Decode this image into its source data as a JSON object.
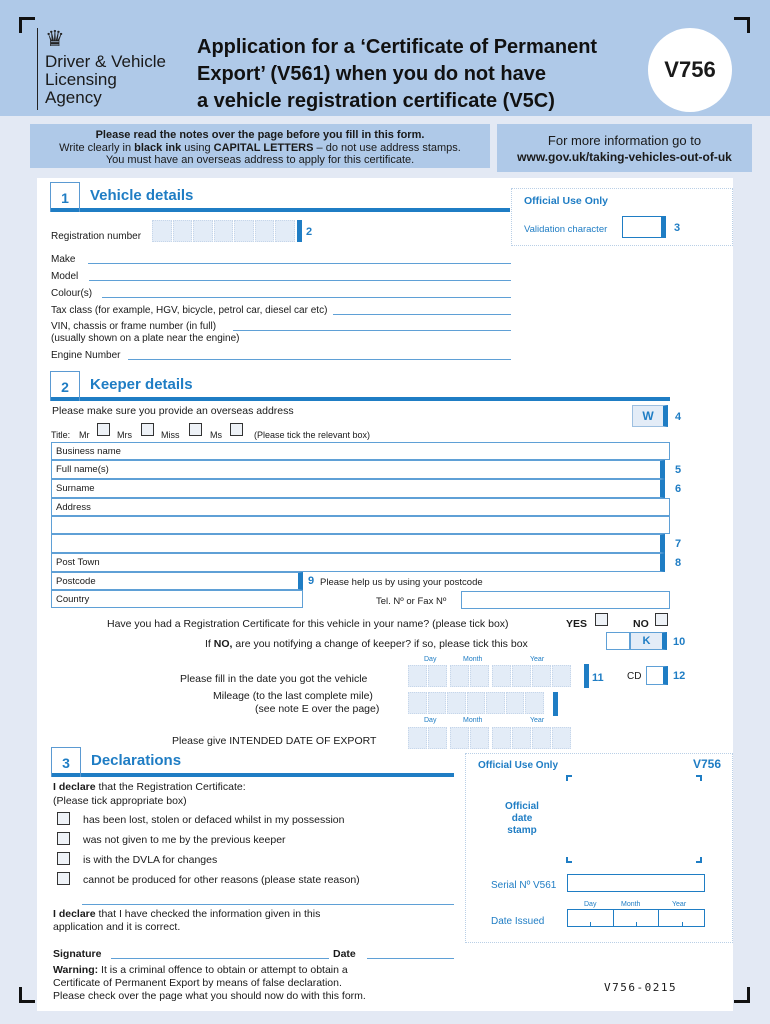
{
  "header": {
    "org_lines": [
      "Driver & Vehicle",
      "Licensing",
      "Agency"
    ],
    "title_lines": [
      "Application for a ‘Certificate of Permanent",
      "Export’ (V561) when you do not have",
      "a vehicle registration certificate (V5C)"
    ],
    "form_code": "V756",
    "crest_icon": "royal-coat-of-arms"
  },
  "notice": {
    "line1": "Please read the notes over the page before you fill in this form.",
    "line2_pre": "Write clearly in ",
    "line2_b1": "black ink",
    "line2_mid": " using ",
    "line2_b2": "CAPITAL LETTERS",
    "line2_post": " – do not use address stamps.",
    "line3": "You must have an overseas address to apply for this certificate."
  },
  "info": {
    "line1": "For more information go to",
    "url": "www.gov.uk/taking-vehicles-out-of-uk"
  },
  "section1": {
    "number": "1",
    "title": "Vehicle details",
    "registration_label": "Registration number",
    "registration_ref": "2",
    "make": "Make",
    "model": "Model",
    "colour": "Colour(s)",
    "tax_class": "Tax class (for example, HGV, bicycle, petrol car, diesel car etc)",
    "vin_line1": "VIN, chassis or frame number (in full)",
    "vin_line2": "(usually shown on a plate near the engine)",
    "engine": "Engine Number"
  },
  "official1": {
    "title": "Official Use Only",
    "validation": "Validation character",
    "ref": "3"
  },
  "section2": {
    "number": "2",
    "title": "Keeper details",
    "overseas_note": "Please make sure you provide an overseas address",
    "w_box": "W",
    "w_ref": "4",
    "title_label": "Title:",
    "titles": [
      "Mr",
      "Mrs",
      "Miss",
      "Ms"
    ],
    "title_hint": "(Please tick the relevant box)",
    "business": "Business name",
    "fullname": "Full name(s)",
    "fullname_ref": "5",
    "surname": "Surname",
    "surname_ref": "6",
    "address": "Address",
    "address_ref": "7",
    "post_town": "Post Town",
    "post_town_ref": "8",
    "postcode": "Postcode",
    "postcode_ref": "9",
    "postcode_hint": "Please help us by using your postcode",
    "country": "Country",
    "tel": "Tel. Nº or Fax Nº",
    "reg_cert_q": "Have you had a Registration Certificate for this vehicle in your name? (please tick box)",
    "yes": "YES",
    "no": "NO",
    "change_pre": "If ",
    "change_bold": "NO,",
    "change_post": " are you notifying a change of keeper? if so, please tick this box",
    "k_box": "K",
    "k_ref": "10",
    "date_got": "Please fill in the date you got the vehicle",
    "date_got_ref": "11",
    "cd_label": "CD",
    "cd_ref": "12",
    "mileage1": "Mileage (to the last complete mile)",
    "mileage2": "(see note E over the page)",
    "export_date": "Please give INTENDED DATE OF EXPORT",
    "day": "Day",
    "month": "Month",
    "year": "Year"
  },
  "section3": {
    "number": "3",
    "title": "Declarations",
    "declare_b": "I declare",
    "declare_rest": " that the Registration Certificate:",
    "tick_hint": "(Please tick appropriate box)",
    "options": [
      "has been lost, stolen or defaced whilst in my possession",
      "was not given to me by the previous keeper",
      "is with the DVLA for changes",
      "cannot be produced for other reasons (please state reason)"
    ],
    "declare2_b": "I declare",
    "declare2_rest": " that I have checked the information given in this",
    "declare2_line2": "application and it is correct.",
    "signature": "Signature",
    "date": "Date",
    "warning_b": "Warning:",
    "warning_rest": " It is a criminal offence to obtain or attempt to obtain a",
    "warning_line2": "Certificate of Permanent Export by means of false declaration.",
    "warning_line3": "Please check over the page what you should now do with this form."
  },
  "official2": {
    "title": "Official Use Only",
    "code": "V756",
    "stamp_lines": [
      "Official",
      "date",
      "stamp"
    ],
    "serial": "Serial Nº V561",
    "date_issued": "Date Issued",
    "day": "Day",
    "month": "Month",
    "year": "Year"
  },
  "footer_code": "V756-0215"
}
